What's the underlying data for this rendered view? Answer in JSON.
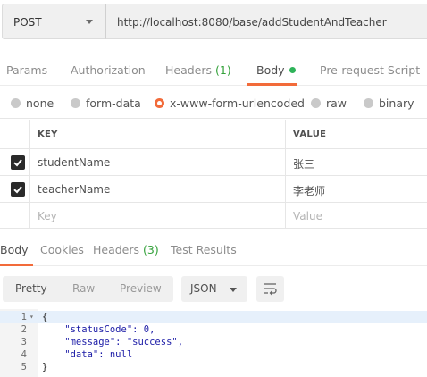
{
  "request": {
    "method": "POST",
    "url": "http://localhost:8080/base/addStudentAndTeacher"
  },
  "request_tabs": [
    {
      "label": "Params"
    },
    {
      "label": "Authorization"
    },
    {
      "label": "Headers ",
      "count": "(1)"
    },
    {
      "label": "Body"
    },
    {
      "label": "Pre-request Script"
    }
  ],
  "body_types": [
    {
      "label": "none"
    },
    {
      "label": "form-data"
    },
    {
      "label": "x-www-form-urlencoded",
      "selected": true
    },
    {
      "label": "raw"
    },
    {
      "label": "binary"
    }
  ],
  "kv_table": {
    "headers": {
      "key": "KEY",
      "value": "VALUE"
    },
    "rows": [
      {
        "key": "studentName",
        "value": "张三",
        "checked": true
      },
      {
        "key": "teacherName",
        "value": "李老师",
        "checked": true
      }
    ],
    "placeholder": {
      "key": "Key",
      "value": "Value"
    }
  },
  "response_tabs": [
    {
      "label": "Body"
    },
    {
      "label": "Cookies"
    },
    {
      "label": "Headers ",
      "count": "(3)"
    },
    {
      "label": "Test Results"
    }
  ],
  "response_toolbar": {
    "views": [
      "Pretty",
      "Raw",
      "Preview"
    ],
    "format": "JSON"
  },
  "response_body": {
    "line_numbers": [
      "1",
      "2",
      "3",
      "4",
      "5"
    ],
    "lines": [
      "{",
      "    \"statusCode\": 0,",
      "    \"message\": \"success\",",
      "    \"data\": null",
      "}"
    ]
  },
  "colors": {
    "accent": "#f26b3a",
    "count_green": "#33a13a",
    "body_dot": "#2eb359"
  },
  "icons": [
    "chevron-down-icon",
    "checkbox-checked-icon",
    "radio-icon",
    "wrap-lines-icon",
    "fold-icon"
  ]
}
